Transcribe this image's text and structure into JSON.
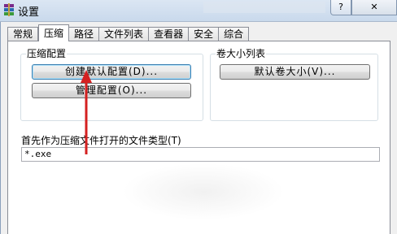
{
  "window": {
    "title": "设置",
    "help_label": "?",
    "close_label": "✕"
  },
  "tabs": [
    {
      "label": "常规",
      "active": false
    },
    {
      "label": "压缩",
      "active": true
    },
    {
      "label": "路径",
      "active": false
    },
    {
      "label": "文件列表",
      "active": false
    },
    {
      "label": "查看器",
      "active": false
    },
    {
      "label": "安全",
      "active": false
    },
    {
      "label": "综合",
      "active": false
    }
  ],
  "compression_profiles": {
    "title": "压缩配置",
    "create_default_label": "创建默认配置(D)...",
    "manage_label": "管理配置(O)..."
  },
  "volume_sizes": {
    "title": "卷大小列表",
    "define_label": "默认卷大小(V)..."
  },
  "file_types": {
    "label": "首先作为压缩文件打开的文件类型(T)",
    "value": "*.exe"
  },
  "colors": {
    "arrow": "#d42020",
    "tab_border": "#898c95",
    "focus_border": "#3c7fb1"
  }
}
